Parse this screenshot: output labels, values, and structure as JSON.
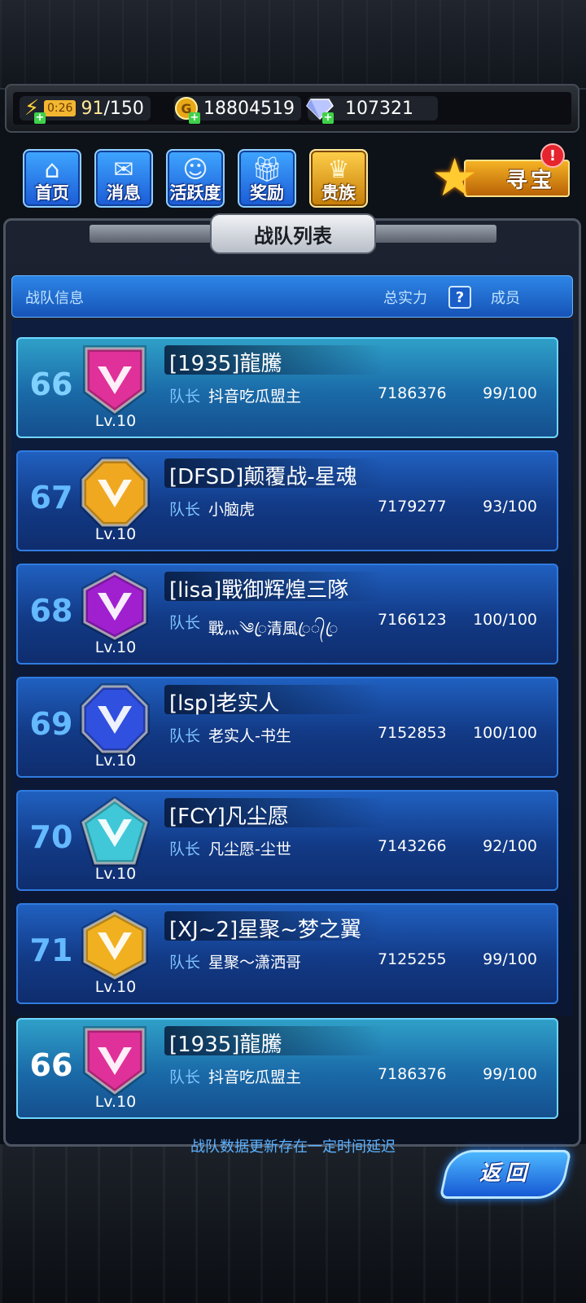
{
  "resources": {
    "energy_timer": "0:26",
    "energy_current": "91",
    "energy_max": "/150",
    "gold": "18804519",
    "diamonds": "107321"
  },
  "nav": {
    "items": [
      {
        "label": "首页",
        "icon": "home-icon"
      },
      {
        "label": "消息",
        "icon": "message-icon"
      },
      {
        "label": "活跃度",
        "icon": "activity-icon"
      },
      {
        "label": "奖励",
        "icon": "gift-icon"
      },
      {
        "label": "贵族",
        "icon": "noble-icon"
      }
    ],
    "treasure_label": "寻宝",
    "treasure_alert": "!"
  },
  "panel": {
    "title": "战队列表",
    "header_info": "战队信息",
    "header_power": "总实力",
    "header_help": "?",
    "header_members": "成员",
    "captain_label": "队长",
    "delay_note": "战队数据更新存在一定时间延迟",
    "back_label": "返回"
  },
  "teams": [
    {
      "rank": "66",
      "name": "[1935]龍騰",
      "captain": "抖音吃瓜盟主",
      "power": "7186376",
      "members": "99/100",
      "level": "Lv.10",
      "emblem_color": "#e0309a",
      "emblem_shape": "shield"
    },
    {
      "rank": "67",
      "name": "[DFSD]颠覆战-星魂",
      "captain": "小脑虎",
      "power": "7179277",
      "members": "93/100",
      "level": "Lv.10",
      "emblem_color": "#f0a820",
      "emblem_shape": "octagon"
    },
    {
      "rank": "68",
      "name": "[lisa]戰御辉煌三隊",
      "captain": "戰灬༄ꦿ清風ꦿ᭄ꦿ",
      "power": "7166123",
      "members": "100/100",
      "level": "Lv.10",
      "emblem_color": "#a020d0",
      "emblem_shape": "hexagon"
    },
    {
      "rank": "69",
      "name": "[lsp]老实人",
      "captain": "老实人-书生",
      "power": "7152853",
      "members": "100/100",
      "level": "Lv.10",
      "emblem_color": "#3050e0",
      "emblem_shape": "octagon"
    },
    {
      "rank": "70",
      "name": "[FCY]凡尘愿",
      "captain": "凡尘愿-尘世",
      "power": "7143266",
      "members": "92/100",
      "level": "Lv.10",
      "emblem_color": "#40c8d8",
      "emblem_shape": "pentagon"
    },
    {
      "rank": "71",
      "name": "[XJ~2]星聚~梦之翼",
      "captain": "星聚～潇洒哥",
      "power": "7125255",
      "members": "99/100",
      "level": "Lv.10",
      "emblem_color": "#f0b020",
      "emblem_shape": "hexagon"
    }
  ],
  "my_team": {
    "rank": "66",
    "name": "[1935]龍騰",
    "captain": "抖音吃瓜盟主",
    "power": "7186376",
    "members": "99/100",
    "level": "Lv.10",
    "emblem_color": "#e0309a",
    "emblem_shape": "shield"
  }
}
